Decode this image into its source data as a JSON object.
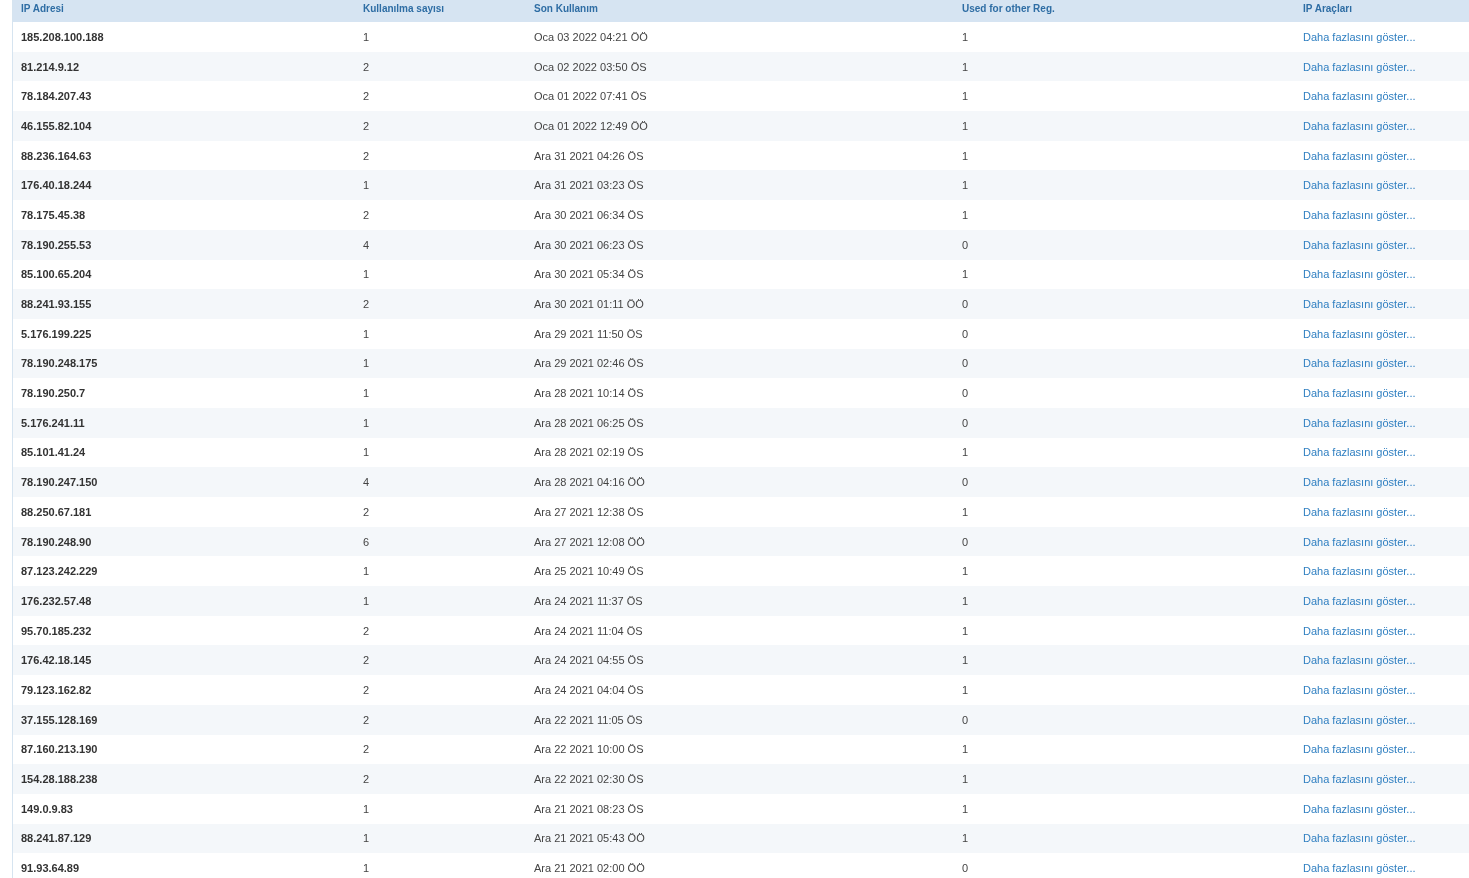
{
  "table": {
    "columns": [
      "IP Adresi",
      "Kullanılma sayısı",
      "Son Kullanım",
      "Used for other Reg.",
      "IP Araçları"
    ],
    "rows": [
      [
        "185.208.100.188",
        "1",
        "Oca 03 2022 04:21 ÖÖ",
        "1",
        "Daha fazlasını göster..."
      ],
      [
        "81.214.9.12",
        "2",
        "Oca 02 2022 03:50 ÖS",
        "1",
        "Daha fazlasını göster..."
      ],
      [
        "78.184.207.43",
        "2",
        "Oca 01 2022 07:41 ÖS",
        "1",
        "Daha fazlasını göster..."
      ],
      [
        "46.155.82.104",
        "2",
        "Oca 01 2022 12:49 ÖÖ",
        "1",
        "Daha fazlasını göster..."
      ],
      [
        "88.236.164.63",
        "2",
        "Ara 31 2021 04:26 ÖS",
        "1",
        "Daha fazlasını göster..."
      ],
      [
        "176.40.18.244",
        "1",
        "Ara 31 2021 03:23 ÖS",
        "1",
        "Daha fazlasını göster..."
      ],
      [
        "78.175.45.38",
        "2",
        "Ara 30 2021 06:34 ÖS",
        "1",
        "Daha fazlasını göster..."
      ],
      [
        "78.190.255.53",
        "4",
        "Ara 30 2021 06:23 ÖS",
        "0",
        "Daha fazlasını göster..."
      ],
      [
        "85.100.65.204",
        "1",
        "Ara 30 2021 05:34 ÖS",
        "1",
        "Daha fazlasını göster..."
      ],
      [
        "88.241.93.155",
        "2",
        "Ara 30 2021 01:11 ÖÖ",
        "0",
        "Daha fazlasını göster..."
      ],
      [
        "5.176.199.225",
        "1",
        "Ara 29 2021 11:50 ÖS",
        "0",
        "Daha fazlasını göster..."
      ],
      [
        "78.190.248.175",
        "1",
        "Ara 29 2021 02:46 ÖS",
        "0",
        "Daha fazlasını göster..."
      ],
      [
        "78.190.250.7",
        "1",
        "Ara 28 2021 10:14 ÖS",
        "0",
        "Daha fazlasını göster..."
      ],
      [
        "5.176.241.11",
        "1",
        "Ara 28 2021 06:25 ÖS",
        "0",
        "Daha fazlasını göster..."
      ],
      [
        "85.101.41.24",
        "1",
        "Ara 28 2021 02:19 ÖS",
        "1",
        "Daha fazlasını göster..."
      ],
      [
        "78.190.247.150",
        "4",
        "Ara 28 2021 04:16 ÖÖ",
        "0",
        "Daha fazlasını göster..."
      ],
      [
        "88.250.67.181",
        "2",
        "Ara 27 2021 12:38 ÖS",
        "1",
        "Daha fazlasını göster..."
      ],
      [
        "78.190.248.90",
        "6",
        "Ara 27 2021 12:08 ÖÖ",
        "0",
        "Daha fazlasını göster..."
      ],
      [
        "87.123.242.229",
        "1",
        "Ara 25 2021 10:49 ÖS",
        "1",
        "Daha fazlasını göster..."
      ],
      [
        "176.232.57.48",
        "1",
        "Ara 24 2021 11:37 ÖS",
        "1",
        "Daha fazlasını göster..."
      ],
      [
        "95.70.185.232",
        "2",
        "Ara 24 2021 11:04 ÖS",
        "1",
        "Daha fazlasını göster..."
      ],
      [
        "176.42.18.145",
        "2",
        "Ara 24 2021 04:55 ÖS",
        "1",
        "Daha fazlasını göster..."
      ],
      [
        "79.123.162.82",
        "2",
        "Ara 24 2021 04:04 ÖS",
        "1",
        "Daha fazlasını göster..."
      ],
      [
        "37.155.128.169",
        "2",
        "Ara 22 2021 11:05 ÖS",
        "0",
        "Daha fazlasını göster..."
      ],
      [
        "87.160.213.190",
        "2",
        "Ara 22 2021 10:00 ÖS",
        "1",
        "Daha fazlasını göster..."
      ],
      [
        "154.28.188.238",
        "2",
        "Ara 22 2021 02:30 ÖS",
        "1",
        "Daha fazlasını göster..."
      ],
      [
        "149.0.9.83",
        "1",
        "Ara 21 2021 08:23 ÖS",
        "1",
        "Daha fazlasını göster..."
      ],
      [
        "88.241.87.129",
        "1",
        "Ara 21 2021 05:43 ÖÖ",
        "1",
        "Daha fazlasını göster..."
      ],
      [
        "91.93.64.89",
        "1",
        "Ara 21 2021 02:00 ÖÖ",
        "0",
        "Daha fazlasını göster..."
      ]
    ]
  }
}
